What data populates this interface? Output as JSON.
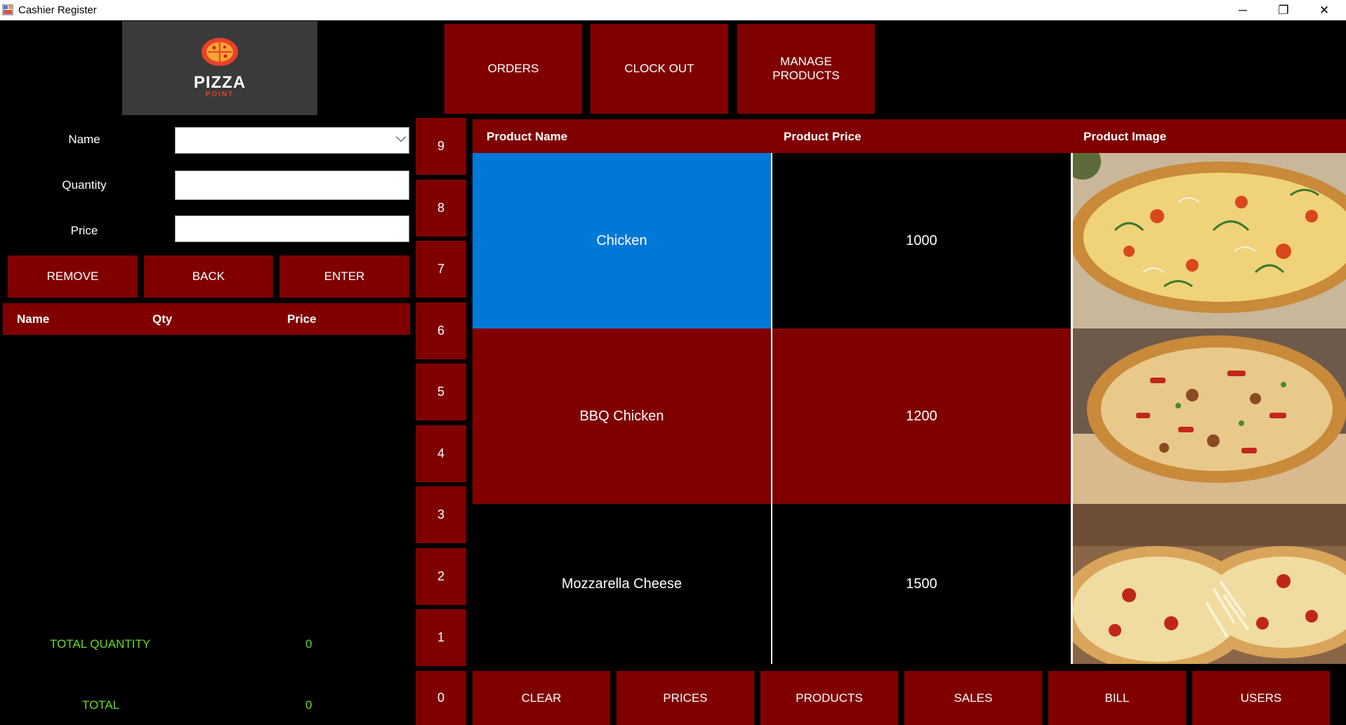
{
  "window": {
    "title": "Cashier Register",
    "minimize": "─",
    "maximize": "❐",
    "close": "✕"
  },
  "logo": {
    "name": "PIZZA",
    "sub": "POINT"
  },
  "top_buttons": {
    "orders": "ORDERS",
    "clock_out": "CLOCK OUT",
    "manage_products_1": "MANAGE",
    "manage_products_2": "PRODUCTS"
  },
  "form": {
    "name_label": "Name",
    "name_value": "",
    "quantity_label": "Quantity",
    "quantity_value": "",
    "price_label": "Price",
    "price_value": ""
  },
  "actions": {
    "remove": "REMOVE",
    "back": "BACK",
    "enter": "ENTER"
  },
  "cart": {
    "headers": {
      "name": "Name",
      "qty": "Qty",
      "price": "Price"
    },
    "rows": []
  },
  "totals": {
    "total_quantity_label": "TOTAL QUANTITY",
    "total_quantity_value": "0",
    "total_label": "TOTAL",
    "total_value": "0"
  },
  "numpad": [
    "9",
    "8",
    "7",
    "6",
    "5",
    "4",
    "3",
    "2",
    "1",
    "0"
  ],
  "products": {
    "headers": {
      "name": "Product Name",
      "price": "Product Price",
      "image": "Product Image"
    },
    "rows": [
      {
        "name": "Chicken",
        "price": "1000",
        "selected": true
      },
      {
        "name": "BBQ Chicken",
        "price": "1200",
        "selected": false
      },
      {
        "name": "Mozzarella Cheese",
        "price": "1500",
        "selected": false
      }
    ]
  },
  "bottom_buttons": {
    "clear": "CLEAR",
    "prices": "PRICES",
    "products": "PRODUCTS",
    "sales": "SALES",
    "bill": "BILL",
    "users": "USERS"
  },
  "colors": {
    "accent": "#800000",
    "selected": "#0078d7",
    "totals": "#66dd1a",
    "background": "#000000"
  }
}
